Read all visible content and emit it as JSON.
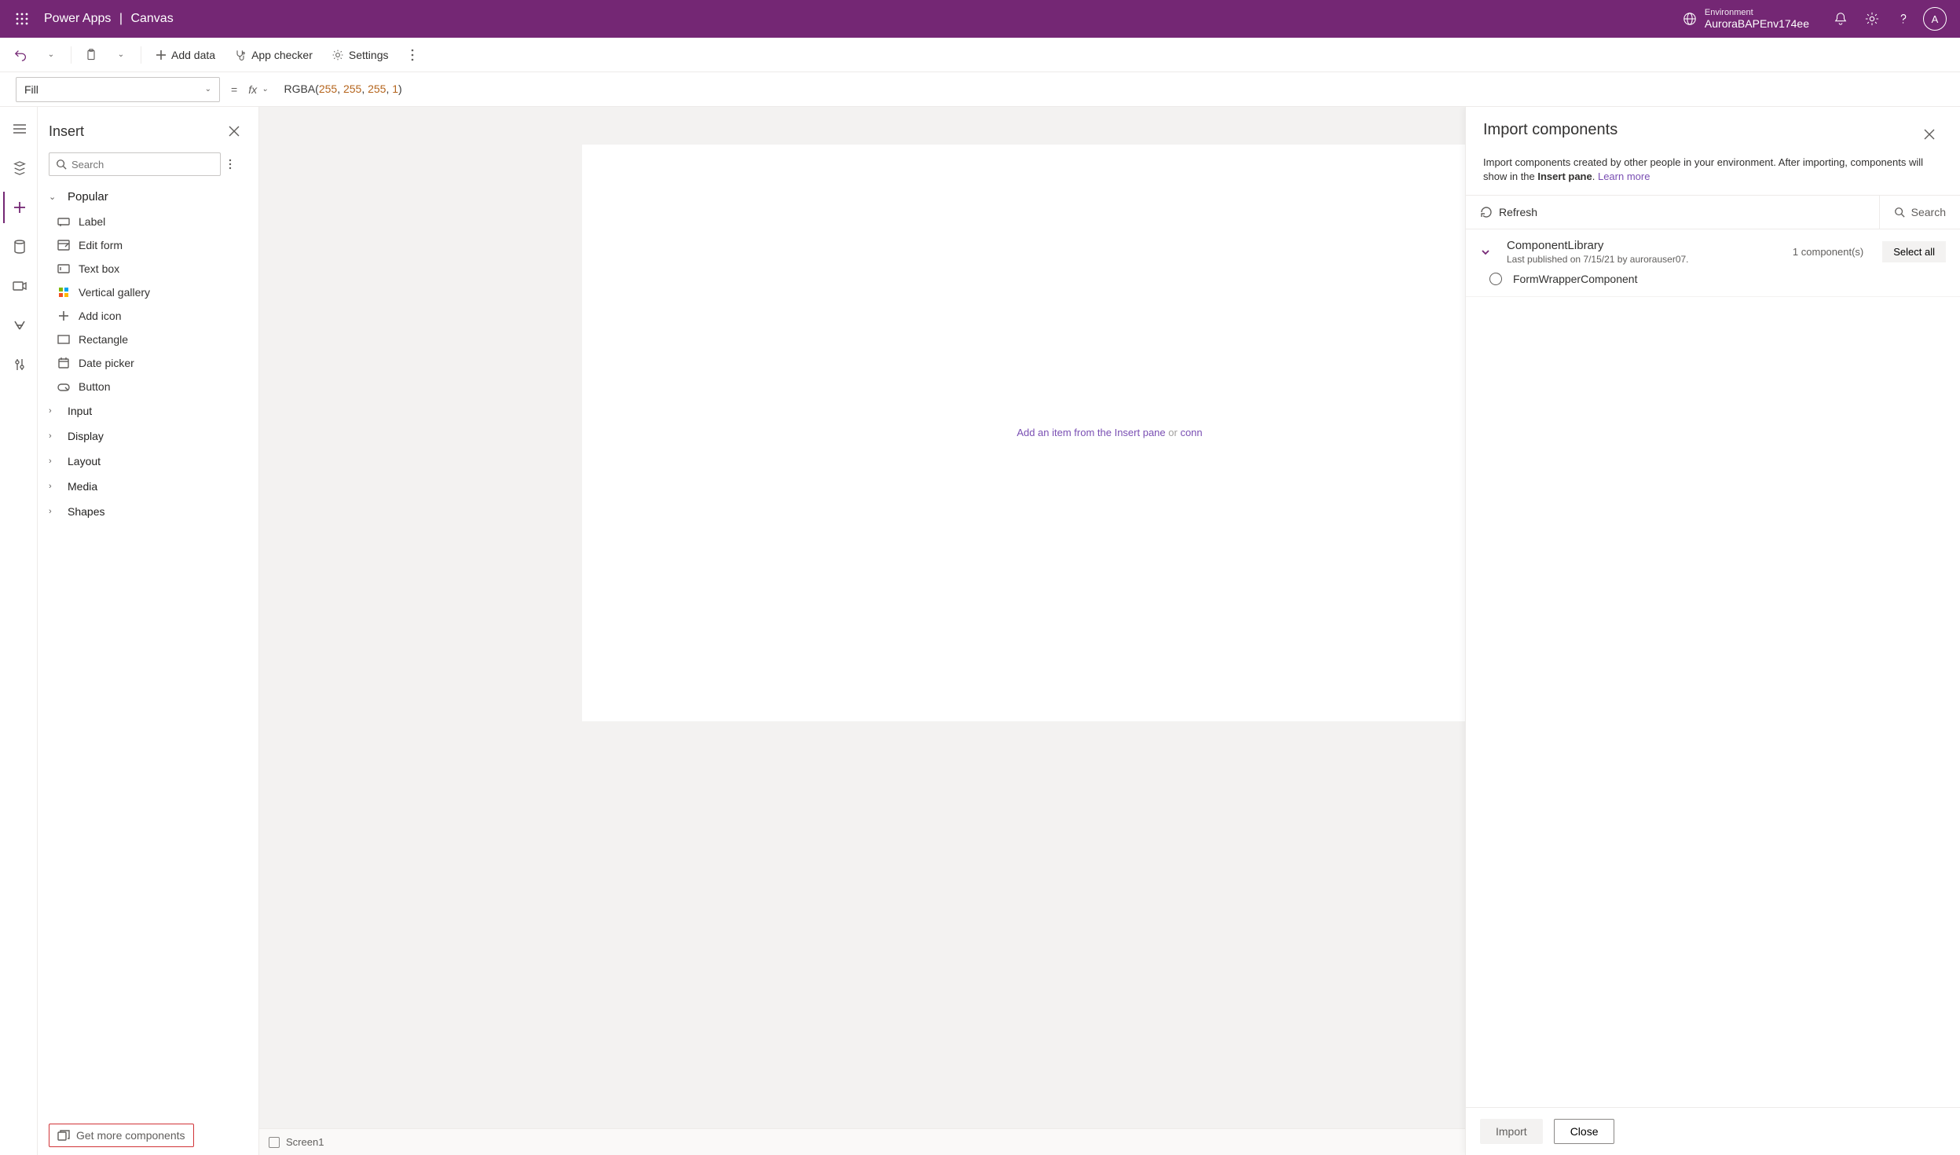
{
  "titlebar": {
    "brand_left": "Power Apps",
    "brand_right": "Canvas",
    "env_label": "Environment",
    "env_value": "AuroraBAPEnv174ee",
    "avatar_initial": "A"
  },
  "cmdbar": {
    "add_data": "Add data",
    "app_checker": "App checker",
    "settings": "Settings"
  },
  "formula": {
    "property": "Fill",
    "fx": "fx",
    "func": "RGBA",
    "args": [
      "255",
      "255",
      "255",
      "1"
    ]
  },
  "insert": {
    "title": "Insert",
    "search_placeholder": "Search",
    "popular": "Popular",
    "items": [
      "Label",
      "Edit form",
      "Text box",
      "Vertical gallery",
      "Add icon",
      "Rectangle",
      "Date picker",
      "Button"
    ],
    "groups": [
      "Input",
      "Display",
      "Layout",
      "Media",
      "Shapes"
    ],
    "get_more": "Get more components"
  },
  "canvas": {
    "hint_left": "Add an item from the Insert pane",
    "hint_or": "or",
    "hint_right": "conn",
    "footer_screen": "Screen1"
  },
  "drawer": {
    "title": "Import components",
    "desc_1": "Import components created by other people in your environment. After importing, components will show in the ",
    "desc_b": "Insert pane",
    "desc_2": ". ",
    "learn_more": "Learn more",
    "refresh": "Refresh",
    "search": "Search",
    "library_name": "ComponentLibrary",
    "library_sub": "Last published on 7/15/21 by aurorauser07.",
    "count": "1 component(s)",
    "select_all": "Select all",
    "component": "FormWrapperComponent",
    "import_btn": "Import",
    "close_btn": "Close"
  }
}
